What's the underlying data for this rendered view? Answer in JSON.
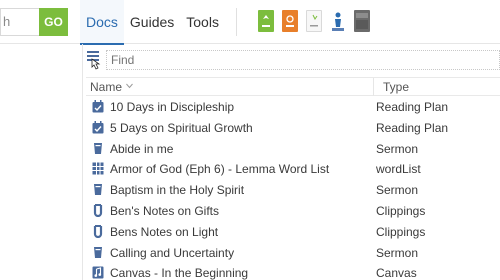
{
  "topbar": {
    "search_partial": "h",
    "go_label": "GO",
    "tabs": [
      {
        "label": "Docs",
        "active": true
      },
      {
        "label": "Guides",
        "active": false
      },
      {
        "label": "Tools",
        "active": false
      }
    ],
    "tool_icons": [
      "green-book-icon",
      "orange-book-icon",
      "white-book-icon",
      "reading-person-icon",
      "gray-book-icon"
    ]
  },
  "filter": {
    "button_icon": "filter-icon",
    "find_placeholder": "Find"
  },
  "table": {
    "columns": {
      "name": "Name",
      "type": "Type"
    },
    "sort_indicator": "chevron-down-icon",
    "rows": [
      {
        "name": "10 Days in Discipleship",
        "type": "Reading Plan",
        "icon": "calendar-check-icon"
      },
      {
        "name": "5 Days on Spiritual Growth",
        "type": "Reading Plan",
        "icon": "calendar-check-icon"
      },
      {
        "name": "Abide in me",
        "type": "Sermon",
        "icon": "sermon-icon"
      },
      {
        "name": "Armor of God (Eph 6) - Lemma Word List",
        "type": "wordList",
        "icon": "grid-list-icon"
      },
      {
        "name": "Baptism in the Holy Spirit",
        "type": "Sermon",
        "icon": "sermon-icon"
      },
      {
        "name": "Ben's Notes on Gifts",
        "type": "Clippings",
        "icon": "clip-icon"
      },
      {
        "name": "Bens Notes on Light",
        "type": "Clippings",
        "icon": "clip-icon"
      },
      {
        "name": "Calling and Uncertainty",
        "type": "Sermon",
        "icon": "sermon-icon"
      },
      {
        "name": "Canvas - In the Beginning",
        "type": "Canvas",
        "icon": "music-canvas-icon"
      }
    ]
  },
  "colors": {
    "accent_blue": "#2b6cb0",
    "icon_blue": "#4a6a9c",
    "go_green": "#7cbd3d"
  }
}
